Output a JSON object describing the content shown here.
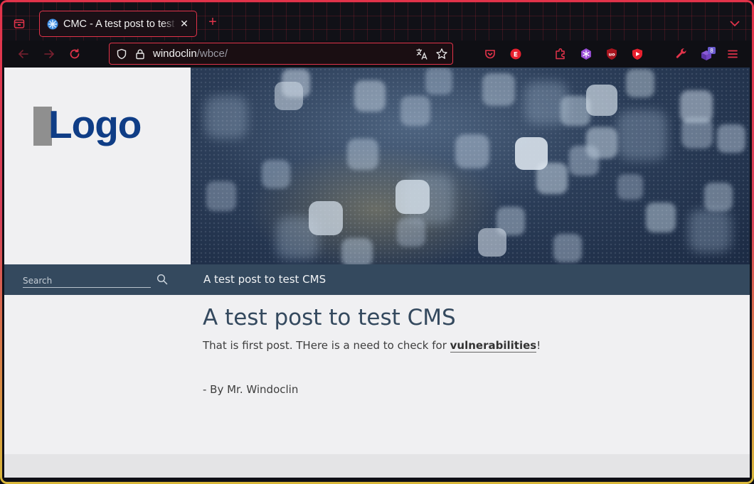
{
  "browser": {
    "tab": {
      "title": "CMC - A test post to test CMS",
      "close_glyph": "✕"
    },
    "new_tab_glyph": "+",
    "url": {
      "host": "windoclin",
      "path": "/wbce/"
    },
    "extensions": {
      "badge_count": "8"
    },
    "colors": {
      "accent": "#e2334a",
      "frame": "#0f0f14"
    }
  },
  "site": {
    "logo_text": "Logo",
    "search": {
      "placeholder": "Search"
    },
    "menu": {
      "active_item": "A test post to test CMS"
    },
    "post": {
      "title": "A test post to test CMS",
      "body_before": "That is first post. THere is a need to check for ",
      "link_text": "vulnerabilities",
      "body_after": "!",
      "author": "- By Mr. Windoclin"
    },
    "colors": {
      "menu_bg": "#34495e",
      "title": "#34495e",
      "logo": "#0f3d86"
    }
  }
}
